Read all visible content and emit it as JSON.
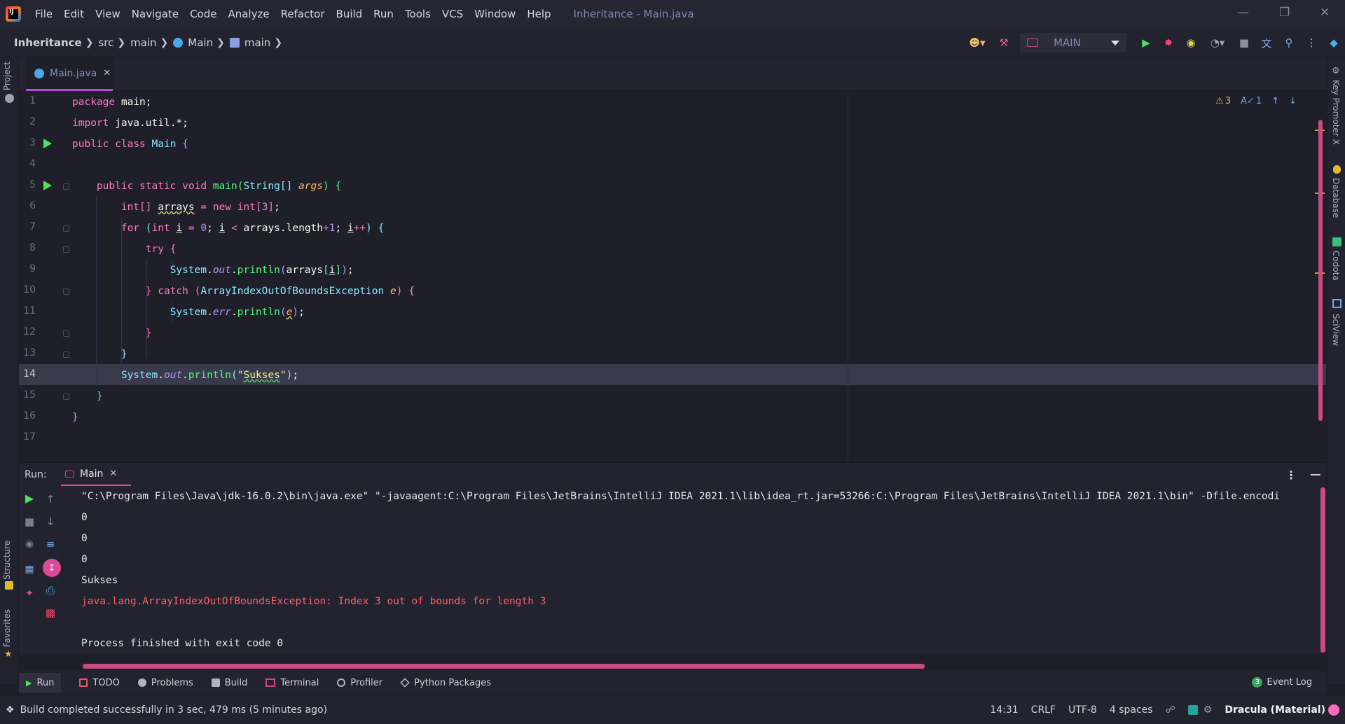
{
  "menubar": {
    "items": [
      "File",
      "Edit",
      "View",
      "Navigate",
      "Code",
      "Analyze",
      "Refactor",
      "Build",
      "Run",
      "Tools",
      "VCS",
      "Window",
      "Help"
    ],
    "window_title": "Inheritance - Main.java",
    "logo_text": "IJ"
  },
  "breadcrumb": {
    "project": "Inheritance",
    "items": [
      "src",
      "main",
      "Main",
      "main"
    ]
  },
  "run_config": {
    "label": "MAIN"
  },
  "editor_tab": {
    "label": "Main.java"
  },
  "left_strip": {
    "project": "Project",
    "structure": "Structure",
    "favorites": "Favorites"
  },
  "right_strip": {
    "key_promoter": "Key Promoter X",
    "database": "Database",
    "codota": "Codota",
    "sciview": "SciView"
  },
  "inspections": {
    "warnings": "3",
    "typos": "1"
  },
  "editor": {
    "line_numbers": [
      "1",
      "2",
      "3",
      "4",
      "5",
      "6",
      "7",
      "8",
      "9",
      "10",
      "11",
      "12",
      "13",
      "14",
      "15",
      "16",
      "17"
    ],
    "current_line": "14"
  },
  "run_panel": {
    "label": "Run:",
    "tab": "Main",
    "console": [
      "\"C:\\Program Files\\Java\\jdk-16.0.2\\bin\\java.exe\" \"-javaagent:C:\\Program Files\\JetBrains\\IntelliJ IDEA 2021.1\\lib\\idea_rt.jar=53266:C:\\Program Files\\JetBrains\\IntelliJ IDEA 2021.1\\bin\" -Dfile.encodi",
      "0",
      "0",
      "0",
      "Sukses",
      "java.lang.ArrayIndexOutOfBoundsException: Index 3 out of bounds for length 3",
      "",
      "Process finished with exit code 0"
    ]
  },
  "tool_tabs": {
    "run": "Run",
    "todo": "TODO",
    "problems": "Problems",
    "build": "Build",
    "terminal": "Terminal",
    "profiler": "Profiler",
    "python_packages": "Python Packages",
    "event_log": "Event Log",
    "event_count": "3"
  },
  "statusbar": {
    "message": "Build completed successfully in 3 sec, 479 ms (5 minutes ago)",
    "position": "14:31",
    "line_sep": "CRLF",
    "encoding": "UTF-8",
    "indent": "4 spaces",
    "theme": "Dracula (Material)"
  },
  "colors": {
    "accent": "#d94c95",
    "run_green": "#50e05c",
    "keyword": "#ff79c6",
    "class": "#8be9fd",
    "error": "#ff5f6d"
  }
}
